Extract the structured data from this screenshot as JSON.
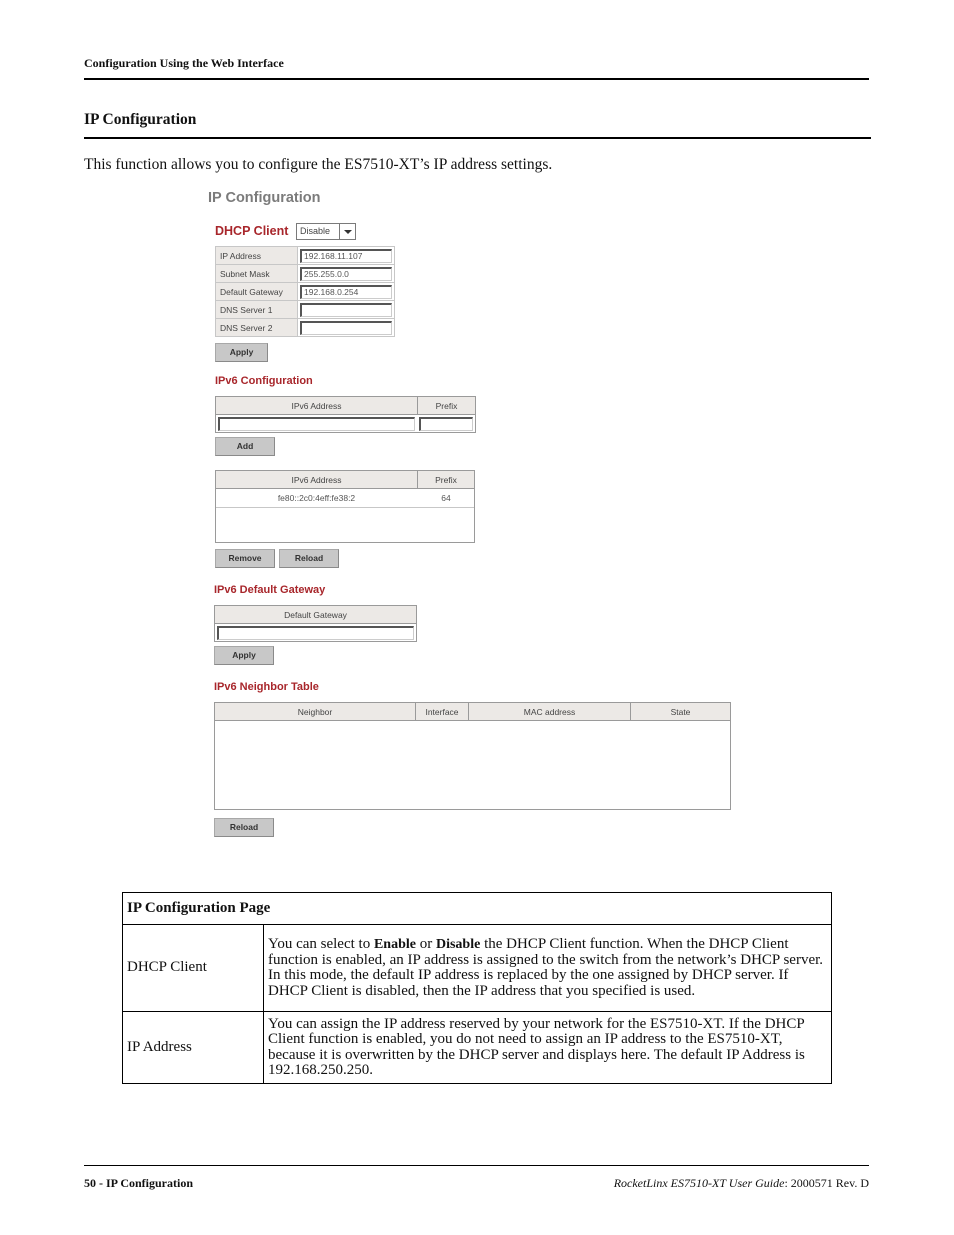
{
  "doc": {
    "running_header": "Configuration Using the Web Interface",
    "section_title": "IP Configuration",
    "intro": "This function allows you to configure the ES7510-XT’s IP address settings.",
    "footer_left": "50 - IP Configuration",
    "footer_right_italic": "RocketLinx ES7510-XT  User Guide",
    "footer_right_plain": ": 2000571 Rev. D"
  },
  "ui": {
    "title": "IP Configuration",
    "dhcp": {
      "label": "DHCP Client",
      "selected": "Disable"
    },
    "ipv4_fields": [
      {
        "label": "IP Address",
        "value": "192.168.11.107"
      },
      {
        "label": "Subnet Mask",
        "value": "255.255.0.0"
      },
      {
        "label": "Default Gateway",
        "value": "192.168.0.254"
      },
      {
        "label": "DNS Server 1",
        "value": ""
      },
      {
        "label": "DNS Server 2",
        "value": ""
      }
    ],
    "apply_label": "Apply",
    "ipv6_config": {
      "heading": "IPv6 Configuration",
      "input_headers": [
        "IPv6  Address",
        "Prefix"
      ],
      "input_address": "",
      "input_prefix": "",
      "add_label": "Add",
      "list_headers": [
        "IPv6  Address",
        "Prefix"
      ],
      "rows": [
        {
          "address": "fe80::2c0:4eff:fe38:2",
          "prefix": "64"
        }
      ],
      "remove_label": "Remove",
      "reload_label": "Reload"
    },
    "ipv6_gateway": {
      "heading": "IPv6 Default Gateway",
      "header": "Default Gateway",
      "value": "",
      "apply_label": "Apply"
    },
    "neighbor_table": {
      "heading": "IPv6 Neighbor Table",
      "headers": [
        "Neighbor",
        "Interface",
        "MAC address",
        "State"
      ],
      "rows": [],
      "reload_label": "Reload"
    }
  },
  "desc_table": {
    "title": "IP Configuration Page",
    "rows": [
      {
        "name": "DHCP Client",
        "text_pre": "You can select to ",
        "bold1": "Enable",
        "text_mid": " or ",
        "bold2": "Disable",
        "text_post": " the DHCP Client function. When the DHCP Client function is enabled, an IP address is assigned to the switch from the network’s DHCP server. In this mode, the default IP address is replaced by the one assigned by DHCP server. If DHCP Client is disabled, then the IP address that you specified is used."
      },
      {
        "name": "IP Address",
        "text": "You can assign the IP address reserved by your network for the ES7510-XT. If the DHCP Client function is enabled, you do not need to assign an IP address to the ES7510-XT, because it is overwritten by the DHCP server and displays here. The default IP Address is 192.168.250.250."
      }
    ]
  }
}
